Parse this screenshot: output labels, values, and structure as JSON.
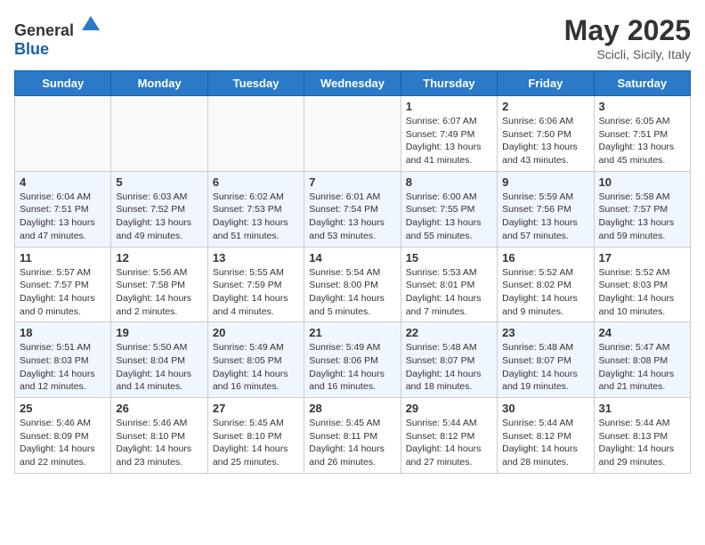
{
  "header": {
    "logo_general": "General",
    "logo_blue": "Blue",
    "month_year": "May 2025",
    "location": "Scicli, Sicily, Italy"
  },
  "weekdays": [
    "Sunday",
    "Monday",
    "Tuesday",
    "Wednesday",
    "Thursday",
    "Friday",
    "Saturday"
  ],
  "weeks": [
    {
      "even": false,
      "days": [
        {
          "date": "",
          "info": ""
        },
        {
          "date": "",
          "info": ""
        },
        {
          "date": "",
          "info": ""
        },
        {
          "date": "",
          "info": ""
        },
        {
          "date": "1",
          "info": "Sunrise: 6:07 AM\nSunset: 7:49 PM\nDaylight: 13 hours\nand 41 minutes."
        },
        {
          "date": "2",
          "info": "Sunrise: 6:06 AM\nSunset: 7:50 PM\nDaylight: 13 hours\nand 43 minutes."
        },
        {
          "date": "3",
          "info": "Sunrise: 6:05 AM\nSunset: 7:51 PM\nDaylight: 13 hours\nand 45 minutes."
        }
      ]
    },
    {
      "even": true,
      "days": [
        {
          "date": "4",
          "info": "Sunrise: 6:04 AM\nSunset: 7:51 PM\nDaylight: 13 hours\nand 47 minutes."
        },
        {
          "date": "5",
          "info": "Sunrise: 6:03 AM\nSunset: 7:52 PM\nDaylight: 13 hours\nand 49 minutes."
        },
        {
          "date": "6",
          "info": "Sunrise: 6:02 AM\nSunset: 7:53 PM\nDaylight: 13 hours\nand 51 minutes."
        },
        {
          "date": "7",
          "info": "Sunrise: 6:01 AM\nSunset: 7:54 PM\nDaylight: 13 hours\nand 53 minutes."
        },
        {
          "date": "8",
          "info": "Sunrise: 6:00 AM\nSunset: 7:55 PM\nDaylight: 13 hours\nand 55 minutes."
        },
        {
          "date": "9",
          "info": "Sunrise: 5:59 AM\nSunset: 7:56 PM\nDaylight: 13 hours\nand 57 minutes."
        },
        {
          "date": "10",
          "info": "Sunrise: 5:58 AM\nSunset: 7:57 PM\nDaylight: 13 hours\nand 59 minutes."
        }
      ]
    },
    {
      "even": false,
      "days": [
        {
          "date": "11",
          "info": "Sunrise: 5:57 AM\nSunset: 7:57 PM\nDaylight: 14 hours\nand 0 minutes."
        },
        {
          "date": "12",
          "info": "Sunrise: 5:56 AM\nSunset: 7:58 PM\nDaylight: 14 hours\nand 2 minutes."
        },
        {
          "date": "13",
          "info": "Sunrise: 5:55 AM\nSunset: 7:59 PM\nDaylight: 14 hours\nand 4 minutes."
        },
        {
          "date": "14",
          "info": "Sunrise: 5:54 AM\nSunset: 8:00 PM\nDaylight: 14 hours\nand 5 minutes."
        },
        {
          "date": "15",
          "info": "Sunrise: 5:53 AM\nSunset: 8:01 PM\nDaylight: 14 hours\nand 7 minutes."
        },
        {
          "date": "16",
          "info": "Sunrise: 5:52 AM\nSunset: 8:02 PM\nDaylight: 14 hours\nand 9 minutes."
        },
        {
          "date": "17",
          "info": "Sunrise: 5:52 AM\nSunset: 8:03 PM\nDaylight: 14 hours\nand 10 minutes."
        }
      ]
    },
    {
      "even": true,
      "days": [
        {
          "date": "18",
          "info": "Sunrise: 5:51 AM\nSunset: 8:03 PM\nDaylight: 14 hours\nand 12 minutes."
        },
        {
          "date": "19",
          "info": "Sunrise: 5:50 AM\nSunset: 8:04 PM\nDaylight: 14 hours\nand 14 minutes."
        },
        {
          "date": "20",
          "info": "Sunrise: 5:49 AM\nSunset: 8:05 PM\nDaylight: 14 hours\nand 16 minutes."
        },
        {
          "date": "21",
          "info": "Sunrise: 5:49 AM\nSunset: 8:06 PM\nDaylight: 14 hours\nand 16 minutes."
        },
        {
          "date": "22",
          "info": "Sunrise: 5:48 AM\nSunset: 8:07 PM\nDaylight: 14 hours\nand 18 minutes."
        },
        {
          "date": "23",
          "info": "Sunrise: 5:48 AM\nSunset: 8:07 PM\nDaylight: 14 hours\nand 19 minutes."
        },
        {
          "date": "24",
          "info": "Sunrise: 5:47 AM\nSunset: 8:08 PM\nDaylight: 14 hours\nand 21 minutes."
        }
      ]
    },
    {
      "even": false,
      "days": [
        {
          "date": "25",
          "info": "Sunrise: 5:46 AM\nSunset: 8:09 PM\nDaylight: 14 hours\nand 22 minutes."
        },
        {
          "date": "26",
          "info": "Sunrise: 5:46 AM\nSunset: 8:10 PM\nDaylight: 14 hours\nand 23 minutes."
        },
        {
          "date": "27",
          "info": "Sunrise: 5:45 AM\nSunset: 8:10 PM\nDaylight: 14 hours\nand 25 minutes."
        },
        {
          "date": "28",
          "info": "Sunrise: 5:45 AM\nSunset: 8:11 PM\nDaylight: 14 hours\nand 26 minutes."
        },
        {
          "date": "29",
          "info": "Sunrise: 5:44 AM\nSunset: 8:12 PM\nDaylight: 14 hours\nand 27 minutes."
        },
        {
          "date": "30",
          "info": "Sunrise: 5:44 AM\nSunset: 8:12 PM\nDaylight: 14 hours\nand 28 minutes."
        },
        {
          "date": "31",
          "info": "Sunrise: 5:44 AM\nSunset: 8:13 PM\nDaylight: 14 hours\nand 29 minutes."
        }
      ]
    }
  ]
}
